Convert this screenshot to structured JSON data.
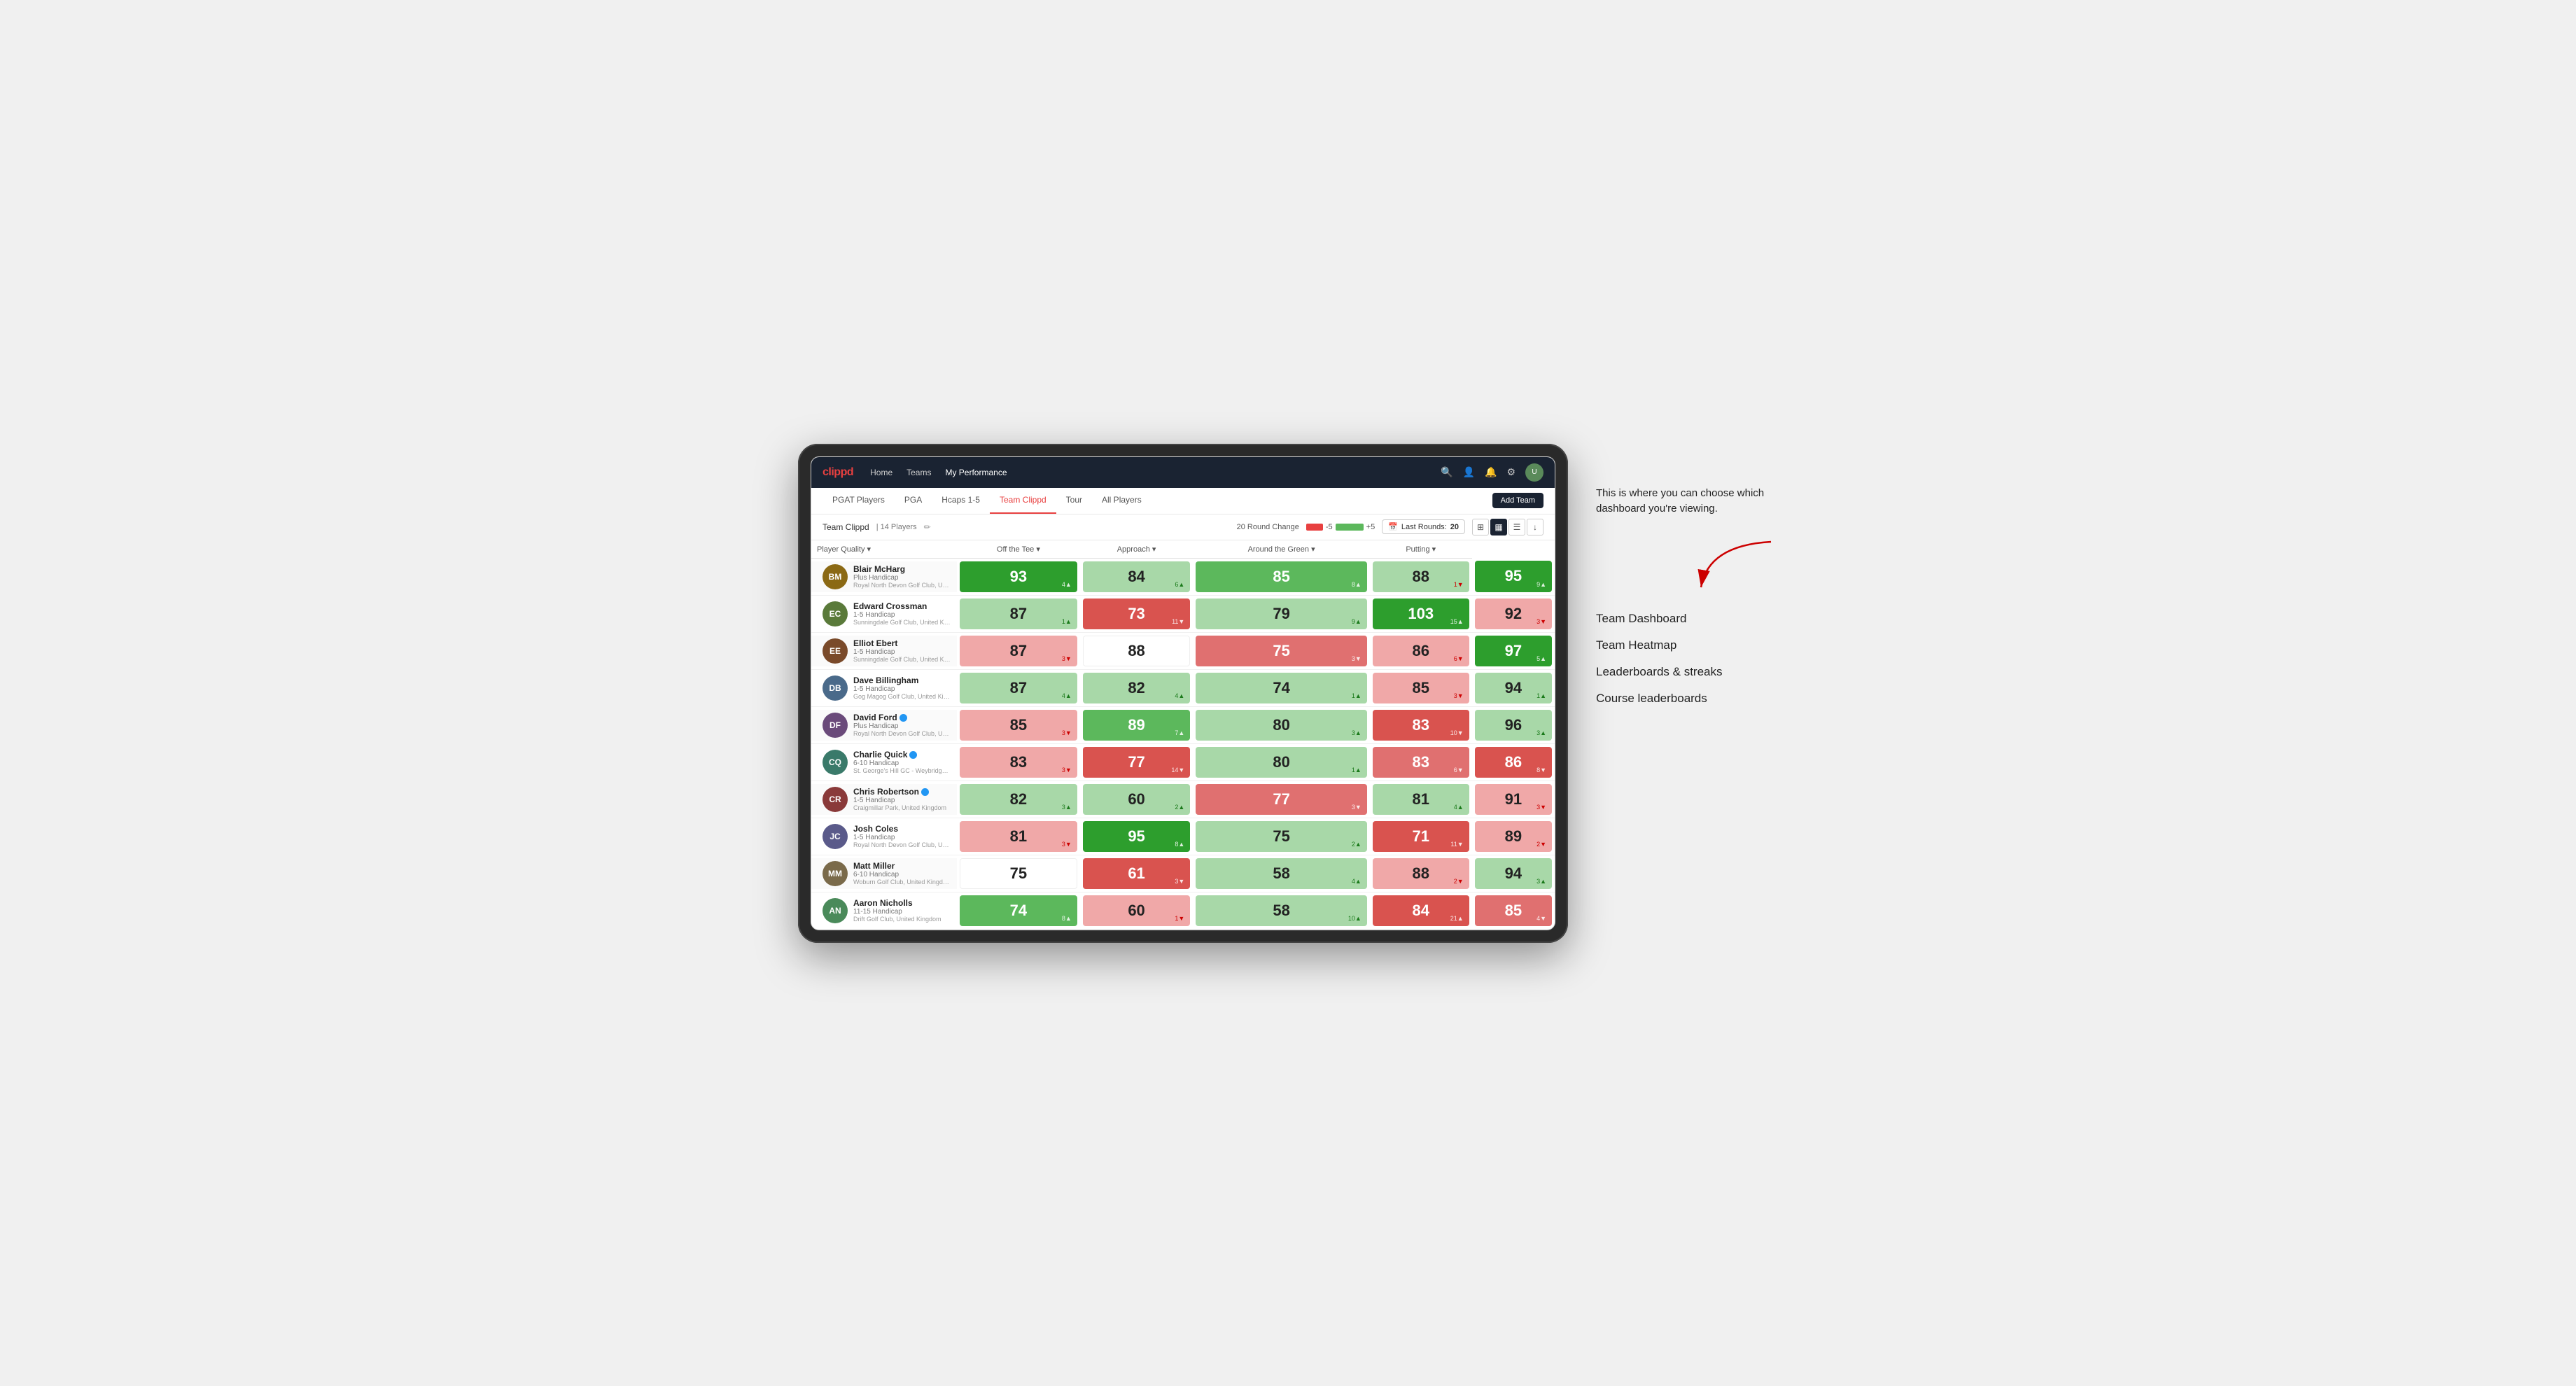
{
  "annotation": {
    "intro_text": "This is where you can choose which dashboard you're viewing.",
    "items": [
      {
        "label": "Team Dashboard"
      },
      {
        "label": "Team Heatmap"
      },
      {
        "label": "Leaderboards & streaks"
      },
      {
        "label": "Course leaderboards"
      }
    ]
  },
  "navbar": {
    "logo": "clippd",
    "links": [
      {
        "label": "Home",
        "active": false
      },
      {
        "label": "Teams",
        "active": false
      },
      {
        "label": "My Performance",
        "active": true
      }
    ],
    "add_team_label": "Add Team"
  },
  "subnav": {
    "tabs": [
      {
        "label": "PGAT Players",
        "active": false
      },
      {
        "label": "PGA",
        "active": false
      },
      {
        "label": "Hcaps 1-5",
        "active": false
      },
      {
        "label": "Team Clippd",
        "active": true
      },
      {
        "label": "Tour",
        "active": false
      },
      {
        "label": "All Players",
        "active": false
      }
    ]
  },
  "team_bar": {
    "name": "Team Clippd",
    "count": "14 Players",
    "round_change_label": "20 Round Change",
    "bar_minus": "-5",
    "bar_plus": "+5",
    "last_rounds_label": "Last Rounds:",
    "last_rounds_value": "20"
  },
  "table": {
    "headers": [
      {
        "label": "Player Quality ▾",
        "align": "left"
      },
      {
        "label": "Off the Tee ▾",
        "align": "center"
      },
      {
        "label": "Approach ▾",
        "align": "center"
      },
      {
        "label": "Around the Green ▾",
        "align": "center"
      },
      {
        "label": "Putting ▾",
        "align": "center"
      }
    ],
    "rows": [
      {
        "name": "Blair McHarg",
        "handicap": "Plus Handicap",
        "club": "Royal North Devon Golf Club, United Kingdom",
        "avatar_initials": "BM",
        "avatar_color": "#8B6914",
        "scores": [
          {
            "value": "93",
            "change": "4▲",
            "direction": "up",
            "bg": "bg-green-dark",
            "light": true
          },
          {
            "value": "84",
            "change": "6▲",
            "direction": "up",
            "bg": "bg-green-light",
            "light": false
          },
          {
            "value": "85",
            "change": "8▲",
            "direction": "up",
            "bg": "bg-green-mid",
            "light": true
          },
          {
            "value": "88",
            "change": "1▼",
            "direction": "down",
            "bg": "bg-green-light",
            "light": false
          },
          {
            "value": "95",
            "change": "9▲",
            "direction": "up",
            "bg": "bg-green-dark",
            "light": true
          }
        ]
      },
      {
        "name": "Edward Crossman",
        "handicap": "1-5 Handicap",
        "club": "Sunningdale Golf Club, United Kingdom",
        "avatar_initials": "EC",
        "avatar_color": "#5a7a3a",
        "scores": [
          {
            "value": "87",
            "change": "1▲",
            "direction": "up",
            "bg": "bg-green-light",
            "light": false
          },
          {
            "value": "73",
            "change": "11▼",
            "direction": "down",
            "bg": "bg-red-dark",
            "light": true
          },
          {
            "value": "79",
            "change": "9▲",
            "direction": "up",
            "bg": "bg-green-light",
            "light": false
          },
          {
            "value": "103",
            "change": "15▲",
            "direction": "up",
            "bg": "bg-green-dark",
            "light": true
          },
          {
            "value": "92",
            "change": "3▼",
            "direction": "down",
            "bg": "bg-red-light",
            "light": false
          }
        ]
      },
      {
        "name": "Elliot Ebert",
        "handicap": "1-5 Handicap",
        "club": "Sunningdale Golf Club, United Kingdom",
        "avatar_initials": "EE",
        "avatar_color": "#7a4a2a",
        "scores": [
          {
            "value": "87",
            "change": "3▼",
            "direction": "down",
            "bg": "bg-red-light",
            "light": false
          },
          {
            "value": "88",
            "change": "",
            "direction": "none",
            "bg": "bg-white",
            "light": false
          },
          {
            "value": "75",
            "change": "3▼",
            "direction": "down",
            "bg": "bg-red-mid",
            "light": true
          },
          {
            "value": "86",
            "change": "6▼",
            "direction": "down",
            "bg": "bg-red-light",
            "light": false
          },
          {
            "value": "97",
            "change": "5▲",
            "direction": "up",
            "bg": "bg-green-dark",
            "light": true
          }
        ]
      },
      {
        "name": "Dave Billingham",
        "handicap": "1-5 Handicap",
        "club": "Gog Magog Golf Club, United Kingdom",
        "avatar_initials": "DB",
        "avatar_color": "#4a6a8a",
        "scores": [
          {
            "value": "87",
            "change": "4▲",
            "direction": "up",
            "bg": "bg-green-light",
            "light": false
          },
          {
            "value": "82",
            "change": "4▲",
            "direction": "up",
            "bg": "bg-green-light",
            "light": false
          },
          {
            "value": "74",
            "change": "1▲",
            "direction": "up",
            "bg": "bg-green-light",
            "light": false
          },
          {
            "value": "85",
            "change": "3▼",
            "direction": "down",
            "bg": "bg-red-light",
            "light": false
          },
          {
            "value": "94",
            "change": "1▲",
            "direction": "up",
            "bg": "bg-green-light",
            "light": false
          }
        ]
      },
      {
        "name": "David Ford",
        "handicap": "Plus Handicap",
        "club": "Royal North Devon Golf Club, United Kingdom",
        "avatar_initials": "DF",
        "avatar_color": "#6a4a7a",
        "verified": true,
        "scores": [
          {
            "value": "85",
            "change": "3▼",
            "direction": "down",
            "bg": "bg-red-light",
            "light": false
          },
          {
            "value": "89",
            "change": "7▲",
            "direction": "up",
            "bg": "bg-green-mid",
            "light": true
          },
          {
            "value": "80",
            "change": "3▲",
            "direction": "up",
            "bg": "bg-green-light",
            "light": false
          },
          {
            "value": "83",
            "change": "10▼",
            "direction": "down",
            "bg": "bg-red-dark",
            "light": true
          },
          {
            "value": "96",
            "change": "3▲",
            "direction": "up",
            "bg": "bg-green-light",
            "light": false
          }
        ]
      },
      {
        "name": "Charlie Quick",
        "handicap": "6-10 Handicap",
        "club": "St. George's Hill GC - Weybridge - Surrey, Uni...",
        "avatar_initials": "CQ",
        "avatar_color": "#3a7a6a",
        "verified": true,
        "scores": [
          {
            "value": "83",
            "change": "3▼",
            "direction": "down",
            "bg": "bg-red-light",
            "light": false
          },
          {
            "value": "77",
            "change": "14▼",
            "direction": "down",
            "bg": "bg-red-dark",
            "light": true
          },
          {
            "value": "80",
            "change": "1▲",
            "direction": "up",
            "bg": "bg-green-light",
            "light": false
          },
          {
            "value": "83",
            "change": "6▼",
            "direction": "down",
            "bg": "bg-red-mid",
            "light": true
          },
          {
            "value": "86",
            "change": "8▼",
            "direction": "down",
            "bg": "bg-red-dark",
            "light": true
          }
        ]
      },
      {
        "name": "Chris Robertson",
        "handicap": "1-5 Handicap",
        "club": "Craigmillar Park, United Kingdom",
        "avatar_initials": "CR",
        "avatar_color": "#8a3a3a",
        "verified": true,
        "scores": [
          {
            "value": "82",
            "change": "3▲",
            "direction": "up",
            "bg": "bg-green-light",
            "light": false
          },
          {
            "value": "60",
            "change": "2▲",
            "direction": "up",
            "bg": "bg-green-light",
            "light": false
          },
          {
            "value": "77",
            "change": "3▼",
            "direction": "down",
            "bg": "bg-red-mid",
            "light": true
          },
          {
            "value": "81",
            "change": "4▲",
            "direction": "up",
            "bg": "bg-green-light",
            "light": false
          },
          {
            "value": "91",
            "change": "3▼",
            "direction": "down",
            "bg": "bg-red-light",
            "light": false
          }
        ]
      },
      {
        "name": "Josh Coles",
        "handicap": "1-5 Handicap",
        "club": "Royal North Devon Golf Club, United Kingdom",
        "avatar_initials": "JC",
        "avatar_color": "#5a5a8a",
        "scores": [
          {
            "value": "81",
            "change": "3▼",
            "direction": "down",
            "bg": "bg-red-light",
            "light": false
          },
          {
            "value": "95",
            "change": "8▲",
            "direction": "up",
            "bg": "bg-green-dark",
            "light": true
          },
          {
            "value": "75",
            "change": "2▲",
            "direction": "up",
            "bg": "bg-green-light",
            "light": false
          },
          {
            "value": "71",
            "change": "11▼",
            "direction": "down",
            "bg": "bg-red-dark",
            "light": true
          },
          {
            "value": "89",
            "change": "2▼",
            "direction": "down",
            "bg": "bg-red-light",
            "light": false
          }
        ]
      },
      {
        "name": "Matt Miller",
        "handicap": "6-10 Handicap",
        "club": "Woburn Golf Club, United Kingdom",
        "avatar_initials": "MM",
        "avatar_color": "#7a6a4a",
        "scores": [
          {
            "value": "75",
            "change": "",
            "direction": "none",
            "bg": "bg-white",
            "light": false
          },
          {
            "value": "61",
            "change": "3▼",
            "direction": "down",
            "bg": "bg-red-dark",
            "light": true
          },
          {
            "value": "58",
            "change": "4▲",
            "direction": "up",
            "bg": "bg-green-light",
            "light": false
          },
          {
            "value": "88",
            "change": "2▼",
            "direction": "down",
            "bg": "bg-red-light",
            "light": false
          },
          {
            "value": "94",
            "change": "3▲",
            "direction": "up",
            "bg": "bg-green-light",
            "light": false
          }
        ]
      },
      {
        "name": "Aaron Nicholls",
        "handicap": "11-15 Handicap",
        "club": "Drift Golf Club, United Kingdom",
        "avatar_initials": "AN",
        "avatar_color": "#4a8a5a",
        "scores": [
          {
            "value": "74",
            "change": "8▲",
            "direction": "up",
            "bg": "bg-green-mid",
            "light": true
          },
          {
            "value": "60",
            "change": "1▼",
            "direction": "down",
            "bg": "bg-red-light",
            "light": false
          },
          {
            "value": "58",
            "change": "10▲",
            "direction": "up",
            "bg": "bg-green-light",
            "light": false
          },
          {
            "value": "84",
            "change": "21▲",
            "direction": "up",
            "bg": "bg-red-dark",
            "light": true
          },
          {
            "value": "85",
            "change": "4▼",
            "direction": "down",
            "bg": "bg-red-mid",
            "light": true
          }
        ]
      }
    ]
  }
}
